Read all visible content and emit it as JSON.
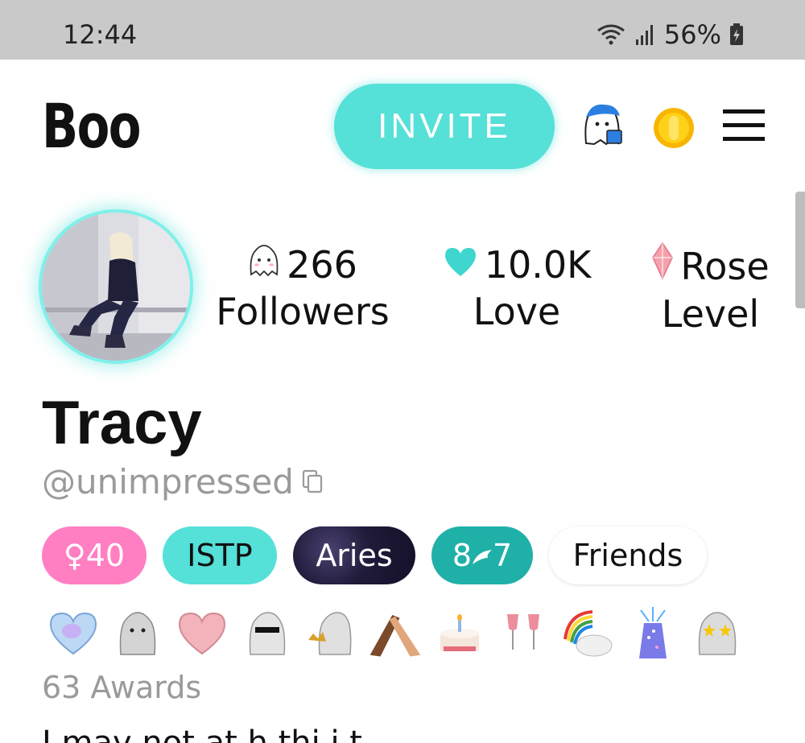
{
  "status_bar": {
    "time": "12:44",
    "battery": "56%"
  },
  "header": {
    "logo": "Boo",
    "invite_label": "INVITE"
  },
  "profile": {
    "followers_count": "266",
    "followers_label": "Followers",
    "love_count": "10.0K",
    "love_label": "Love",
    "level_name": "Rose",
    "level_label": "Level",
    "name": "Tracy",
    "handle": "@unimpressed"
  },
  "chips": {
    "age": "♀40",
    "mbti": "ISTP",
    "zodiac": "Aries",
    "enneagram_left": "8",
    "enneagram_right": "7",
    "looking_for": "Friends"
  },
  "awards": {
    "count_label": "63 Awards",
    "icons": [
      "crystal-heart",
      "ghost",
      "pink-heart",
      "cool-ghost",
      "crown-ghost",
      "handshake",
      "birthday-cake",
      "wine-glasses",
      "rainbow-cloud",
      "sparkle-gift",
      "star-eyes-ghost"
    ]
  },
  "bio_preview": "I may not at h          thi  i        t",
  "colors": {
    "accent": "#55e0d8",
    "pink": "#ff7fc2",
    "teal_dark": "#1fb0a8"
  }
}
